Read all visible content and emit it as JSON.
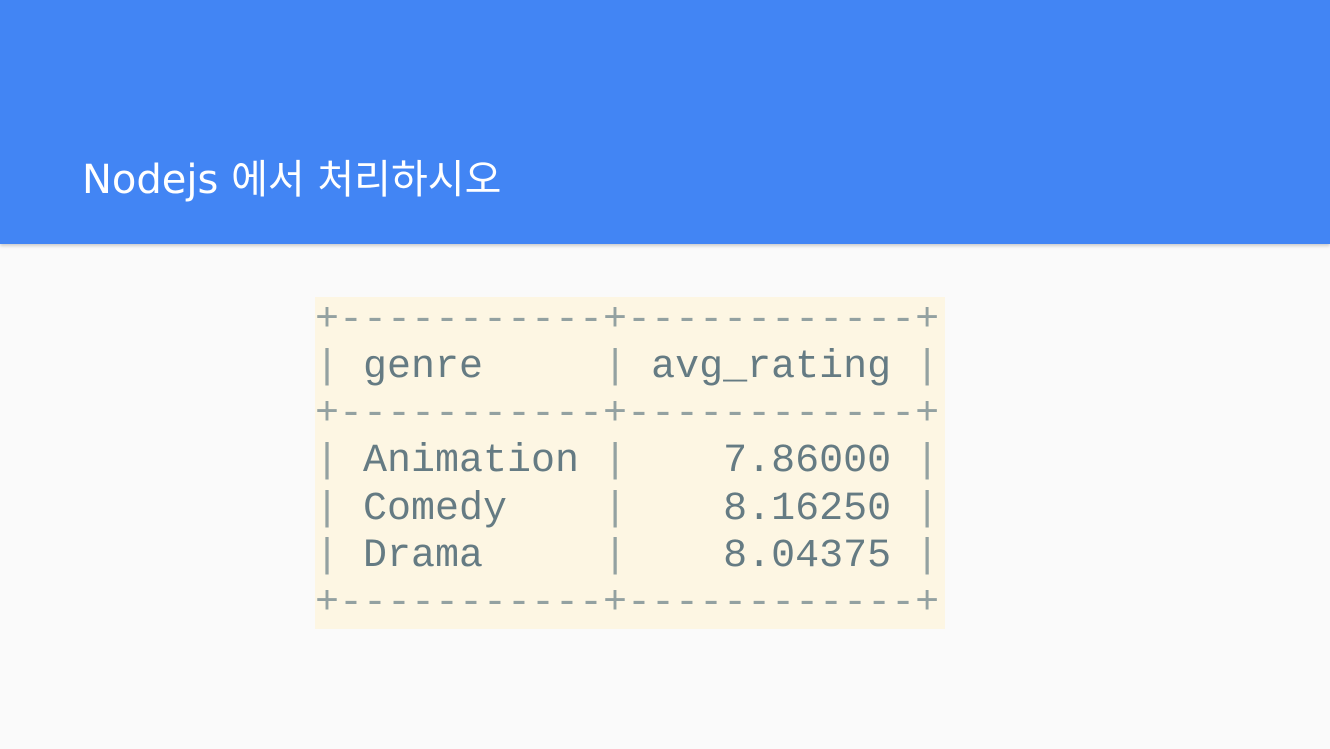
{
  "slide": {
    "title": "Nodejs 에서 처리하시오"
  },
  "result_table": {
    "border_line": "+-----------+------------+",
    "columns": [
      "genre",
      "avg_rating"
    ],
    "rows": [
      {
        "genre": "Animation",
        "avg_rating": "7.86000"
      },
      {
        "genre": "Comedy",
        "avg_rating": "8.16250"
      },
      {
        "genre": "Drama",
        "avg_rating": "8.04375"
      }
    ]
  },
  "colors": {
    "header_background": "#4285f4",
    "code_background": "#fdf6e3",
    "code_text": "#657b83",
    "code_border": "#93a1a1"
  }
}
